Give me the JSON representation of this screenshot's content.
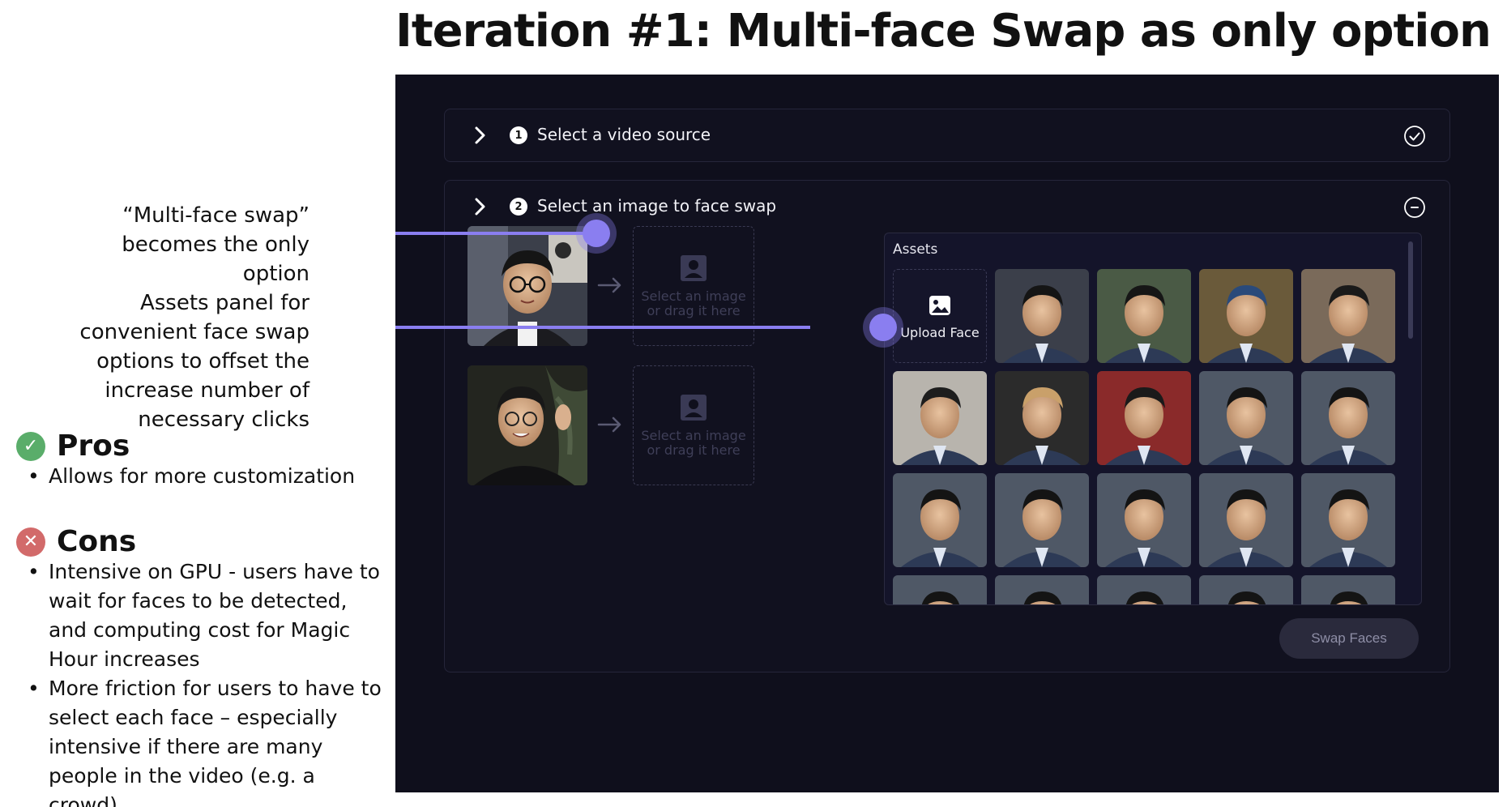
{
  "page_title": "Iteration #1: Multi-face Swap as only option",
  "annotations": [
    "“Multi-face swap” becomes the only option",
    "Assets panel  for convenient face swap options to offset the increase number of necessary clicks"
  ],
  "pros": {
    "title": "Pros",
    "items": [
      "Allows for more customization"
    ]
  },
  "cons": {
    "title": "Cons",
    "items": [
      "Intensive on GPU - users have to wait for faces to be detected, and computing cost for Magic Hour increases",
      "More friction for users to have to select each face – especially intensive if there are many people in the video (e.g. a crowd)"
    ]
  },
  "app": {
    "steps": [
      {
        "number": "1",
        "label": "Select a video source",
        "status_icon": "check-circle-icon"
      },
      {
        "number": "2",
        "label": "Select an image to face swap",
        "status_icon": "minus-circle-icon"
      }
    ],
    "dropzone_text": "Select an image or drag it here",
    "assets": {
      "title": "Assets",
      "upload_label": "Upload Face"
    },
    "swap_button": "Swap Faces"
  },
  "colors": {
    "accent": "#8a7ef0",
    "app_bg": "#0f0f1c",
    "pros": "#5aad6a",
    "cons": "#d26a6a"
  }
}
